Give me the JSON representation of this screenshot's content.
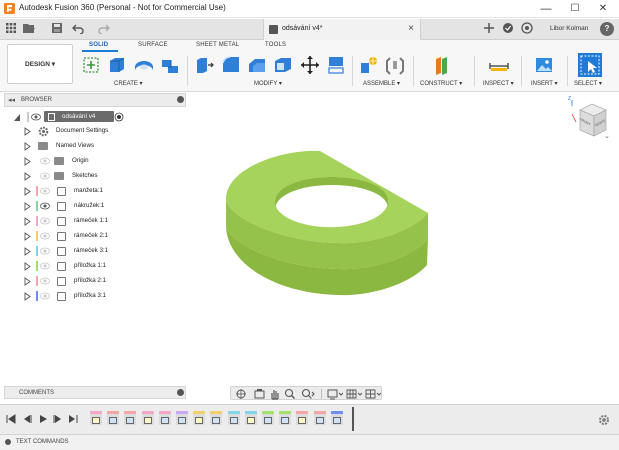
{
  "window": {
    "title": "Autodesk Fusion 360 (Personal - Not for Commercial Use)",
    "minimize": "—",
    "maximize": "☐",
    "close": "✕"
  },
  "quick_access": {
    "document_tab": "odsávání v4*",
    "close_glyph": "×",
    "user": "Libor Kolman",
    "help": "?"
  },
  "ribbon": {
    "workspace_button": "DESIGN ▾",
    "tabs": [
      "SOLID",
      "SURFACE",
      "SHEET METAL",
      "TOOLS"
    ],
    "groups": [
      "CREATE ▾",
      "MODIFY ▾",
      "ASSEMBLE ▾",
      "CONSTRUCT ▾",
      "INSPECT ▾",
      "INSERT ▾",
      "SELECT ▾"
    ]
  },
  "browser": {
    "title": "BROWSER",
    "root": "odsávání v4",
    "items": [
      {
        "label": "Document Settings",
        "icon": "gear-icon"
      },
      {
        "label": "Named Views",
        "icon": "folder-icon"
      },
      {
        "label": "Origin",
        "icon": "folder-icon"
      },
      {
        "label": "Sketches",
        "icon": "folder-icon"
      },
      {
        "label": "manžeta:1",
        "color": "#f4a6a6"
      },
      {
        "label": "nákružek:1",
        "color": "#8ed4a0"
      },
      {
        "label": "rámeček 1:1",
        "color": "#f4a6c6"
      },
      {
        "label": "rámeček 2:1",
        "color": "#f4d06a"
      },
      {
        "label": "rámeček 3:1",
        "color": "#7fd6e6"
      },
      {
        "label": "příložka 1:1",
        "color": "#a4e06a"
      },
      {
        "label": "příložka 2:1",
        "color": "#f4a6a6"
      },
      {
        "label": "příložka 3:1",
        "color": "#6a8ef4"
      }
    ]
  },
  "viewcube": {
    "front": "FRONT",
    "right": "RIGHT",
    "top": "TOP",
    "axis_z": "Z"
  },
  "comments": {
    "title": "COMMENTS"
  },
  "text_commands": {
    "title": "TEXT COMMANDS"
  },
  "model": {
    "color": "#a6d35c"
  },
  "timeline": {
    "feature_colors": [
      "#f4a6c6",
      "#f4a6a6",
      "#f4a6a6",
      "#f4a6c6",
      "#f4a6c6",
      "#c8a6f4",
      "#f4d06a",
      "#f4d06a",
      "#7fd6e6",
      "#7fd6e6",
      "#a4e06a",
      "#a4e06a",
      "#f4a6a6",
      "#f4a6a6",
      "#6a8ef4"
    ]
  }
}
